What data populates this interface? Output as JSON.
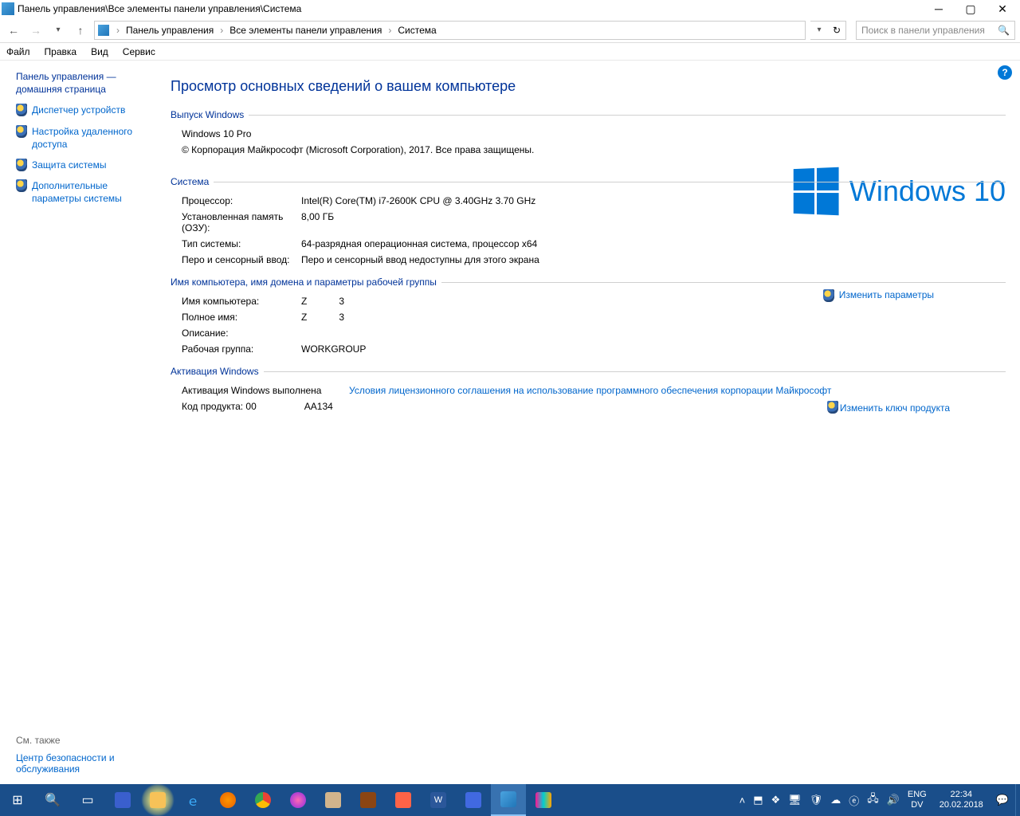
{
  "title": "Панель управления\\Все элементы панели управления\\Система",
  "breadcrumbs": [
    "Панель управления",
    "Все элементы панели управления",
    "Система"
  ],
  "search_placeholder": "Поиск в панели управления",
  "menu": {
    "file": "Файл",
    "edit": "Правка",
    "view": "Вид",
    "service": "Сервис"
  },
  "sidebar": {
    "home": "Панель управления — домашняя страница",
    "items": [
      "Диспетчер устройств",
      "Настройка удаленного доступа",
      "Защита системы",
      "Дополнительные параметры системы"
    ],
    "seealso_head": "См. также",
    "seealso_link": "Центр безопасности и обслуживания"
  },
  "main": {
    "heading": "Просмотр основных сведений о вашем компьютере",
    "edition_head": "Выпуск Windows",
    "edition_name": "Windows 10 Pro",
    "copyright": "© Корпорация Майкрософт (Microsoft Corporation), 2017. Все права защищены.",
    "logo_text": "Windows 10",
    "system_head": "Система",
    "sys": {
      "cpu_l": "Процессор:",
      "cpu_v": "Intel(R) Core(TM) i7-2600K CPU @ 3.40GHz   3.70 GHz",
      "ram_l": "Установленная память (ОЗУ):",
      "ram_v": "8,00 ГБ",
      "type_l": "Тип системы:",
      "type_v": "64-разрядная операционная система, процессор x64",
      "pen_l": "Перо и сенсорный ввод:",
      "pen_v": "Перо и сенсорный ввод недоступны для этого экрана"
    },
    "name_head": "Имя компьютера, имя домена и параметры рабочей группы",
    "name": {
      "comp_l": "Имя компьютера:",
      "comp_v": "Z            3",
      "full_l": "Полное имя:",
      "full_v": "Z            3",
      "desc_l": "Описание:",
      "desc_v": "",
      "wg_l": "Рабочая группа:",
      "wg_v": "WORKGROUP"
    },
    "change_params": "Изменить параметры",
    "activation_head": "Активация Windows",
    "act": {
      "status": "Активация Windows выполнена",
      "terms": "Условия лицензионного соглашения на использование программного обеспечения корпорации Майкрософт",
      "key_l": "Код продукта:",
      "key_v": "00                  AA134"
    },
    "change_key": "Изменить ключ продукта"
  },
  "tray": {
    "lang1": "ENG",
    "lang2": "DV",
    "time": "22:34",
    "date": "20.02.2018"
  }
}
